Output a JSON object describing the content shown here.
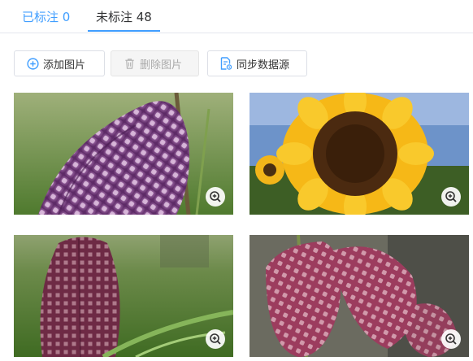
{
  "tabs": [
    {
      "label": "已标注 0",
      "active": false
    },
    {
      "label": "未标注 48",
      "active": true
    }
  ],
  "toolbar": {
    "add_label": "添加图片",
    "delete_label": "删除图片",
    "sync_label": "同步数据源"
  },
  "colors": {
    "accent": "#409eff",
    "border": "#dcdfe6",
    "disabled_text": "#aaaaaa"
  },
  "images": [
    {
      "subject": "purple checkered fritillary flower",
      "icon": "zoom-in-icon"
    },
    {
      "subject": "sunflowers",
      "icon": "zoom-in-icon"
    },
    {
      "subject": "closed fritillary bud in grass",
      "icon": "zoom-in-icon"
    },
    {
      "subject": "pink fritillary flowers",
      "icon": "zoom-in-icon"
    }
  ]
}
